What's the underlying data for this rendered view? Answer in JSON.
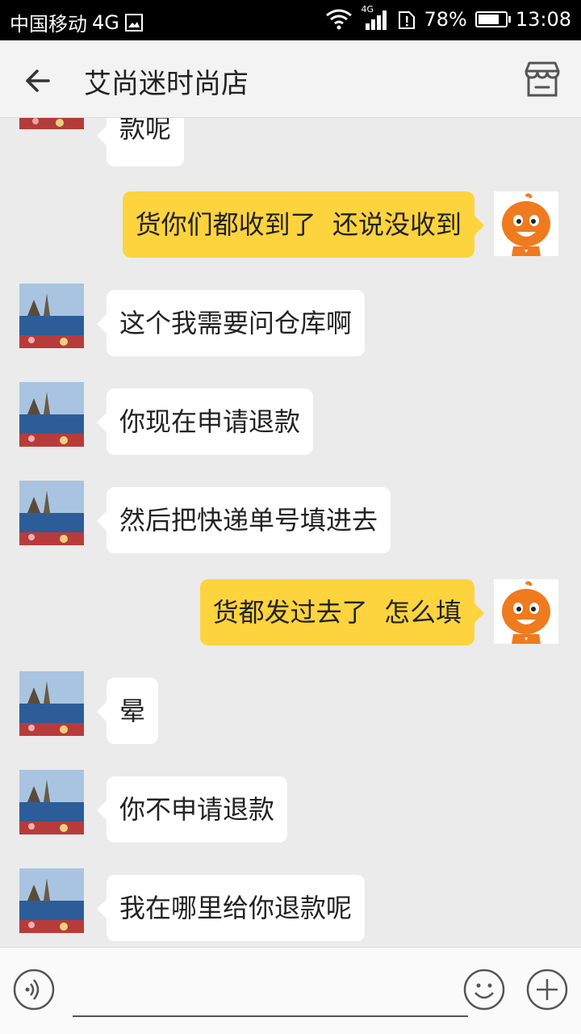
{
  "status_bar": {
    "carrier": "中国移动",
    "network": "4G",
    "signal_network": "4G",
    "battery_percent": "78%",
    "battery_level": 0.78,
    "time": "13:08"
  },
  "header": {
    "title": "艾尚迷时尚店",
    "back_icon": "arrow-left-icon",
    "shop_icon": "store-icon"
  },
  "messages": [
    {
      "side": "left",
      "text": "款呢",
      "partial_above": true
    },
    {
      "side": "right",
      "text": "货你们都收到了  还说没收到"
    },
    {
      "side": "left",
      "text": "这个我需要问仓库啊"
    },
    {
      "side": "left",
      "text": "你现在申请退款"
    },
    {
      "side": "left",
      "text": "然后把快递单号填进去"
    },
    {
      "side": "right",
      "text": "货都发过去了  怎么填"
    },
    {
      "side": "left",
      "text": "晕"
    },
    {
      "side": "left",
      "text": "你不申请退款"
    },
    {
      "side": "left",
      "text": "我在哪里给你退款呢"
    }
  ],
  "bottom_bar": {
    "voice_icon": "voice-icon",
    "emoji_icon": "emoji-icon",
    "plus_icon": "plus-icon"
  },
  "colors": {
    "background": "#ebebeb",
    "self_bubble": "#fdd33e",
    "other_bubble": "#ffffff"
  }
}
